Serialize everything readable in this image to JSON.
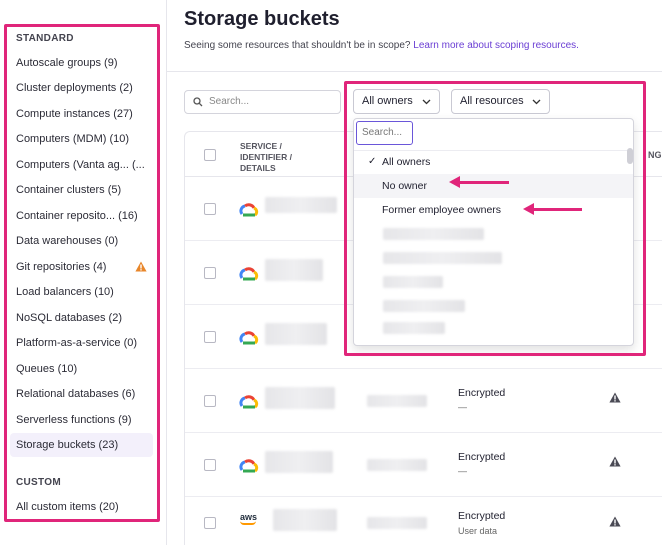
{
  "sidebar": {
    "standard_title": "STANDARD",
    "custom_title": "CUSTOM",
    "items": [
      {
        "label": "Autoscale groups (9)"
      },
      {
        "label": "Cluster deployments (2)"
      },
      {
        "label": "Compute instances (27)"
      },
      {
        "label": "Computers (MDM) (10)"
      },
      {
        "label": "Computers (Vanta ag... (..."
      },
      {
        "label": "Container clusters (5)"
      },
      {
        "label": "Container reposito... (16)"
      },
      {
        "label": "Data warehouses (0)"
      },
      {
        "label": "Git repositories (4)",
        "icon": "warning-icon"
      },
      {
        "label": "Load balancers (10)"
      },
      {
        "label": "NoSQL databases (2)"
      },
      {
        "label": "Platform-as-a-service (0)"
      },
      {
        "label": "Queues (10)"
      },
      {
        "label": "Relational databases (6)"
      },
      {
        "label": "Serverless functions (9)"
      },
      {
        "label": "Storage buckets (23)",
        "active": true
      }
    ],
    "custom_items": [
      {
        "label": "All custom items (20)"
      }
    ]
  },
  "header": {
    "title": "Storage buckets",
    "subtitle": "Seeing some resources that shouldn't be in scope?",
    "link": "Learn more about scoping resources."
  },
  "toolbar": {
    "search_placeholder": "Search...",
    "owners_filter": "All owners",
    "resources_filter": "All resources"
  },
  "table": {
    "column_service": "SERVICE / IDENTIFIER / DETAILS",
    "column_ng": "NG",
    "rows": [
      {
        "provider": "gcloud-icon",
        "status": "",
        "sub": ""
      },
      {
        "provider": "gcloud-icon",
        "status": "",
        "sub": ""
      },
      {
        "provider": "gcloud-icon",
        "status": "",
        "sub": ""
      },
      {
        "provider": "gcloud-icon",
        "status": "Encrypted",
        "sub": "—",
        "alert": true
      },
      {
        "provider": "gcloud-icon",
        "status": "Encrypted",
        "sub": "—",
        "alert": true
      },
      {
        "provider": "aws-icon",
        "provider_label": "aws",
        "status": "Encrypted",
        "sub": "User data",
        "alert": true
      }
    ]
  },
  "dropdown": {
    "search_placeholder": "Search...",
    "options": [
      {
        "label": "All owners",
        "selected": true
      },
      {
        "label": "No owner"
      },
      {
        "label": "Former employee owners"
      }
    ]
  },
  "colors": {
    "highlight": "#e0257a",
    "link": "#6b3fd4",
    "warning": "#e8862a"
  }
}
